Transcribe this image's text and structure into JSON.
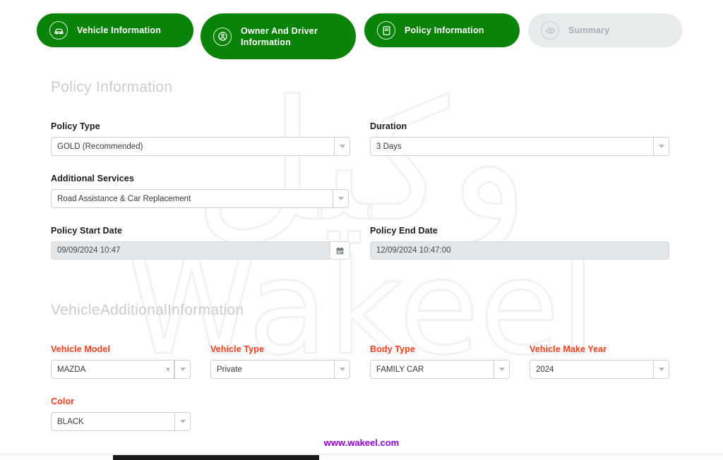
{
  "tabs": [
    {
      "label": "Vehicle Information",
      "icon": "car-icon",
      "state": "active"
    },
    {
      "label": "Owner And Driver Information",
      "icon": "user-circle-icon",
      "state": "active"
    },
    {
      "label": "Policy Information",
      "icon": "document-icon",
      "state": "active"
    },
    {
      "label": "Summary",
      "icon": "eye-icon",
      "state": "inactive"
    }
  ],
  "colors": {
    "tab_active": "#0a8408",
    "tab_inactive": "#e8ebec",
    "required_label": "#fd3a16",
    "section_heading": "#c9cdcf",
    "footer_link": "#8f00e8"
  },
  "policy_section": {
    "heading": "Policy Information",
    "fields": {
      "policy_type": {
        "label": "Policy Type",
        "value": "GOLD (Recommended)"
      },
      "duration": {
        "label": "Duration",
        "value": "3 Days"
      },
      "additional_services": {
        "label": "Additional Services",
        "value": "Road Assistance & Car Replacement"
      },
      "policy_start_date": {
        "label": "Policy Start Date",
        "value": "09/09/2024 10:47"
      },
      "policy_end_date": {
        "label": "Policy End Date",
        "value": "12/09/2024 10:47:00"
      }
    }
  },
  "vehicle_section": {
    "heading": "VehicleAdditionalInformation",
    "fields": {
      "vehicle_model": {
        "label": "Vehicle Model",
        "value": "MAZDA",
        "clear": "×"
      },
      "vehicle_type": {
        "label": "Vehicle Type",
        "value": "Private"
      },
      "body_type": {
        "label": "Body Type",
        "value": "FAMILY CAR"
      },
      "vehicle_make_year": {
        "label": "Vehicle Make Year",
        "value": "2024"
      },
      "color": {
        "label": "Color",
        "value": "BLACK"
      }
    }
  },
  "watermark": {
    "arabic": "وكيل",
    "latin": "Wakeel"
  },
  "footer": {
    "link": "www.wakeel.com"
  }
}
